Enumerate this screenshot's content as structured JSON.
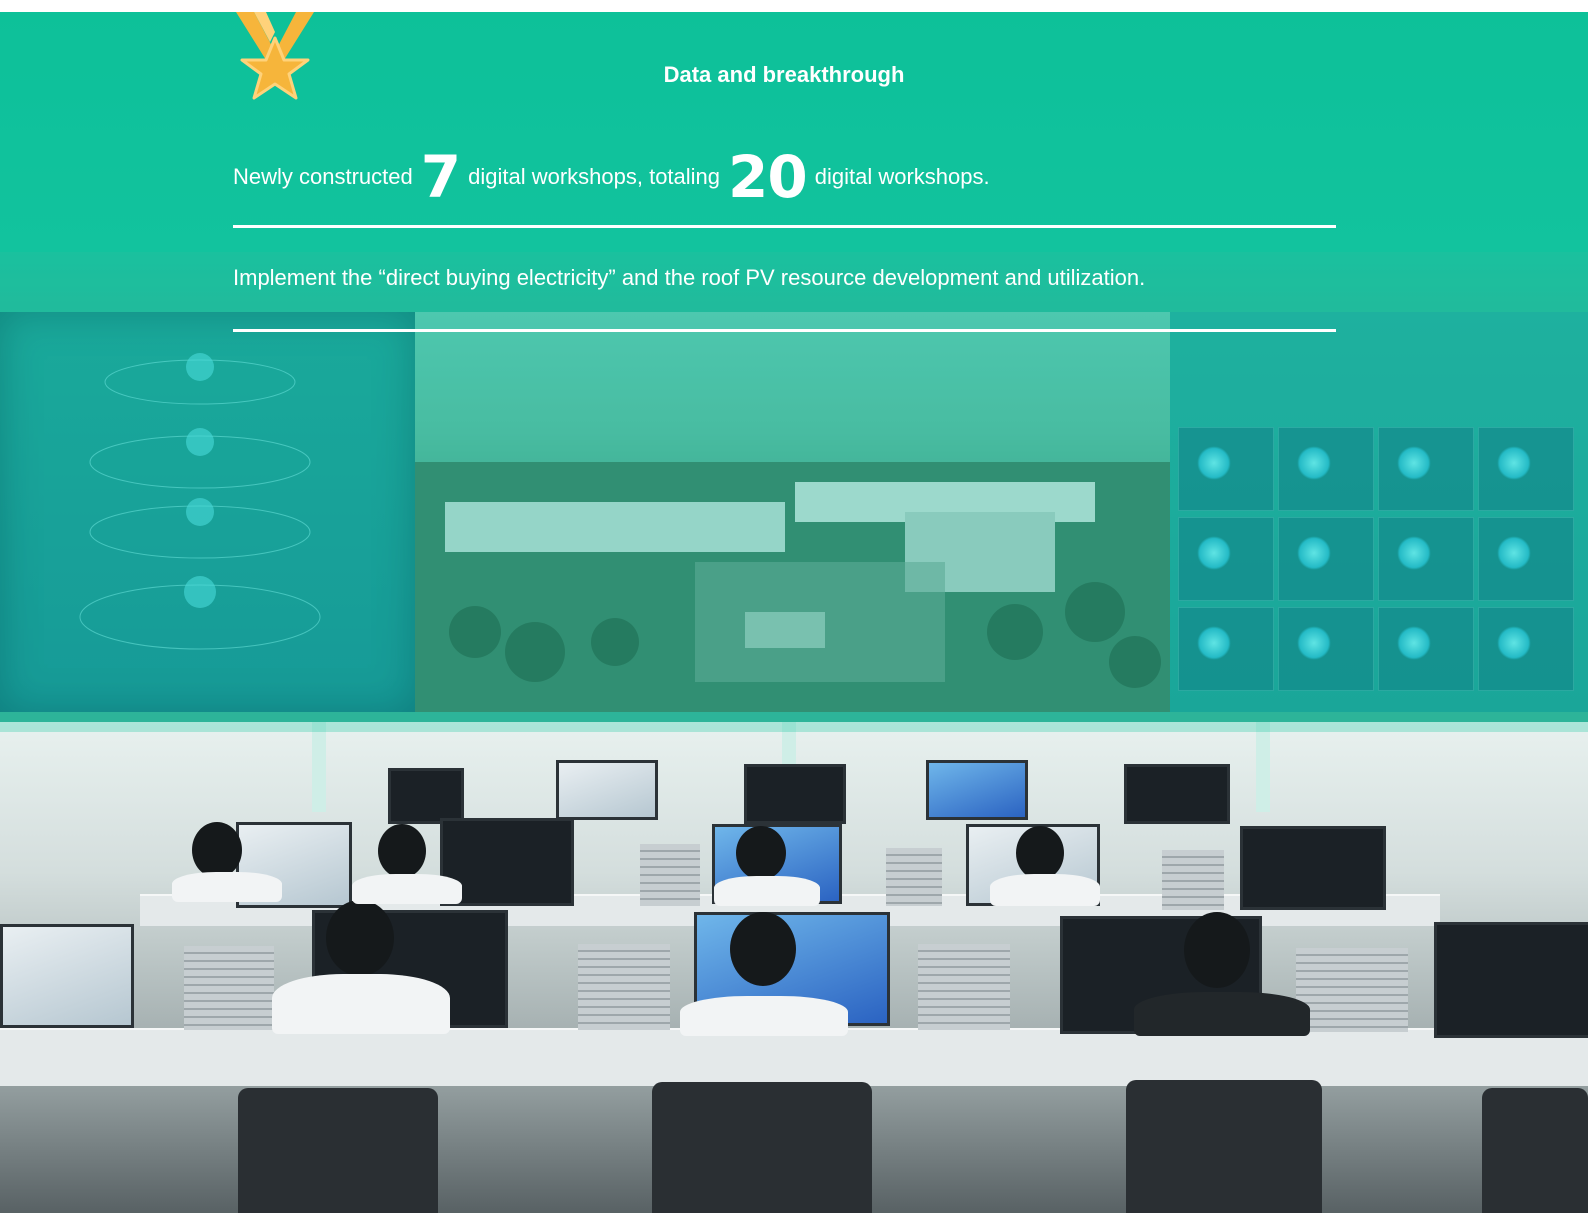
{
  "section": {
    "title": "Data and breakthrough",
    "stat_line": {
      "prefix": "Newly constructed",
      "value_1": "7",
      "middle": "digital workshops, totaling",
      "value_2": "20",
      "suffix": "digital workshops."
    },
    "statement": "Implement the “direct buying electricity” and the roof PV resource development and utilization."
  },
  "icons": {
    "medal": "medal-star-icon"
  },
  "colors": {
    "accent": "#14c29e",
    "medal_gold": "#f6b53b",
    "text": "#ffffff"
  }
}
